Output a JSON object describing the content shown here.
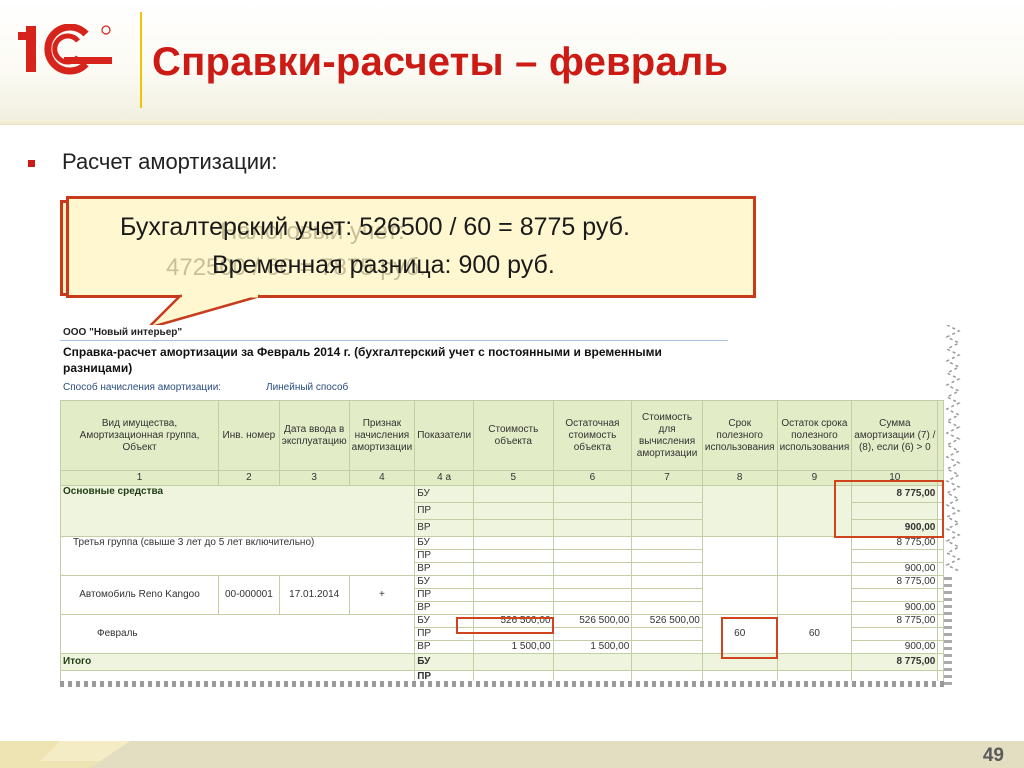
{
  "slide": {
    "title": "Справки-расчеты – февраль",
    "bullet": "Расчет амортизации:",
    "page_number": "49"
  },
  "logo": {
    "text": "1С"
  },
  "callout": {
    "ghost_line1": "Налоговый учет:",
    "ghost_line2": "472500 / 60 = 7875 руб.",
    "line1": "Бухгалтерский учет: 526500 / 60 = 8775 руб.",
    "line2": "Временная разница: 900 руб."
  },
  "report": {
    "org": "ООО \"Новый интерьер\"",
    "title": "Справка-расчет амортизации за Февраль 2014 г. (бухгалтерский учет с постоянными и временными разницами)",
    "method_label": "Способ начисления амортизации:",
    "method_value": "Линейный способ",
    "headers": [
      "Вид имущества, Амортизационная группа, Объект",
      "Инв. номер",
      "Дата ввода в эксплуатацию",
      "Признак начисления амортизации",
      "Показатели",
      "Стоимость объекта",
      "Остаточная стоимость объекта",
      "Стоимость для вычисления амортизации",
      "Срок полезного использования",
      "Остаток срока полезного использования",
      "Сумма амортизации (7) / (8), если (6) > 0"
    ],
    "col_numbers": [
      "1",
      "2",
      "3",
      "4",
      "4 а",
      "5",
      "6",
      "7",
      "8",
      "9",
      "10"
    ],
    "rows": {
      "fixed_assets": {
        "label": "Основные средства",
        "bu": "БУ",
        "pr": "ПР",
        "vr": "ВР",
        "sum_bu": "8 775,00",
        "sum_vr": "900,00"
      },
      "group": {
        "label": "Третья группа (свыше 3 лет до 5 лет включительно)",
        "bu": "БУ",
        "pr": "ПР",
        "vr": "ВР",
        "sum_bu": "8 775,00",
        "sum_vr": "900,00"
      },
      "object": {
        "label": "Автомобиль Reno Kangoo",
        "inv": "00-000001",
        "date": "17.01.2014",
        "flag": "+",
        "bu": "БУ",
        "pr": "ПР",
        "vr": "ВР",
        "sum_bu": "8 775,00",
        "sum_vr": "900,00"
      },
      "month": {
        "label": "Февраль",
        "bu": "БУ",
        "pr": "ПР",
        "vr": "ВР",
        "cost_bu": "526 500,00",
        "resid_bu": "526 500,00",
        "calc_bu": "526 500,00",
        "cost_vr": "1 500,00",
        "resid_vr": "1 500,00",
        "term": "60",
        "term_left": "60",
        "sum_bu": "8 775,00",
        "sum_pr": "",
        "sum_vr": "900,00"
      },
      "total": {
        "label": "Итого",
        "bu": "БУ",
        "pr": "ПР",
        "sum_bu": "8 775,00"
      }
    }
  },
  "colors": {
    "title_red": "#cc1a14",
    "callout_border": "#c73b1c",
    "callout_fill": "#fff7cf",
    "table_header": "#e2ecc6",
    "highlight": "#d0431f"
  }
}
